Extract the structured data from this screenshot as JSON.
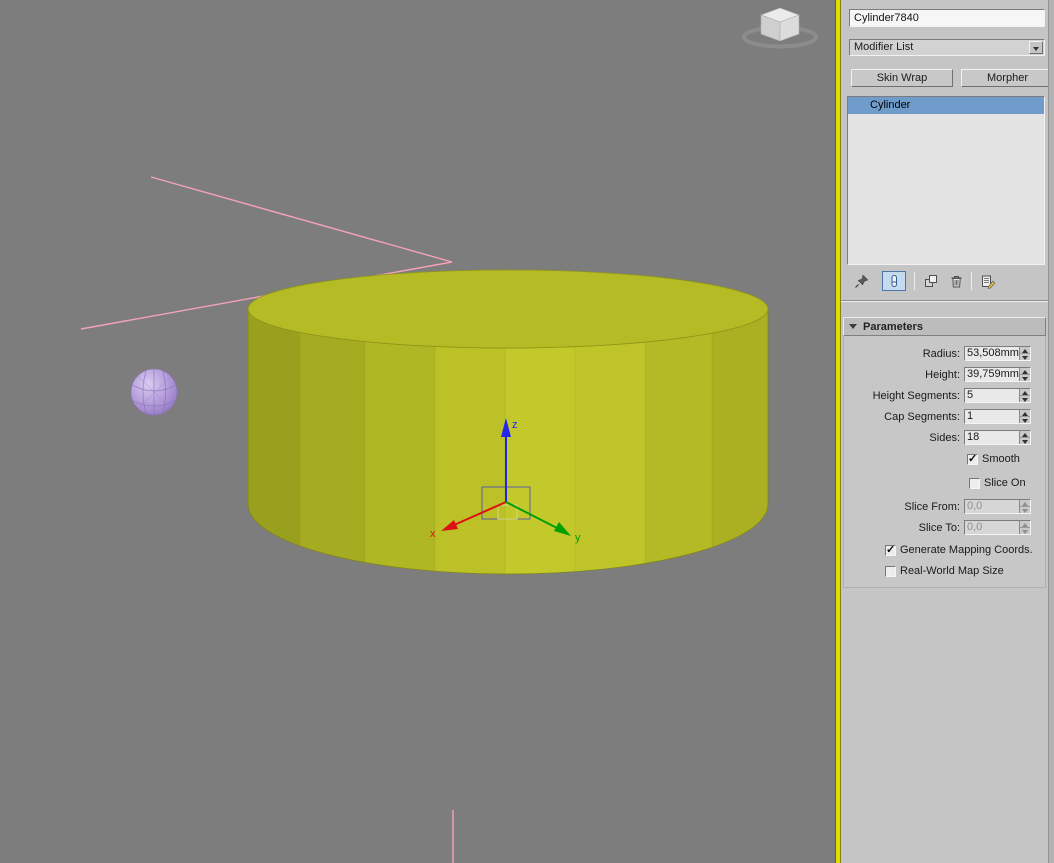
{
  "colors": {
    "viewport_bg": "#7d7d7d",
    "active_viewport_border": "#dede00",
    "panel_bg": "#c5c5c5",
    "selection_blue": "#6f9ccb",
    "cylinder_top": "#b5bb24",
    "cylinder_side": "#bcc228",
    "sphere_purple": "#b39bda",
    "spline_pink": "#f5a2b8",
    "gizmo_x_red": "#dd1111",
    "gizmo_y_green": "#00a000",
    "gizmo_z_blue": "#2525ee"
  },
  "viewport": {
    "gizmo": {
      "x": "x",
      "y": "y",
      "z": "z"
    }
  },
  "panel": {
    "object_name": "Cylinder7840",
    "modifier_list_label": "Modifier List",
    "buttons": [
      {
        "label": "Skin Wrap"
      },
      {
        "label": "Morpher"
      }
    ],
    "stack": {
      "items": [
        {
          "label": "Cylinder",
          "selected": true
        }
      ]
    },
    "stack_tools": [
      {
        "name": "pin-stack"
      },
      {
        "name": "show-end-result",
        "active": true
      },
      {
        "name": "make-unique"
      },
      {
        "name": "remove-modifier"
      },
      {
        "name": "configure-modifier-sets"
      }
    ],
    "rollout": {
      "title": "Parameters",
      "params": [
        {
          "label": "Radius:",
          "value": "53,508mm"
        },
        {
          "label": "Height:",
          "value": "39,759mm"
        },
        {
          "label": "Height Segments:",
          "value": "5"
        },
        {
          "label": "Cap Segments:",
          "value": "1"
        },
        {
          "label": "Sides:",
          "value": "18"
        }
      ],
      "smooth": {
        "label": "Smooth",
        "checked": true
      },
      "slice_on": {
        "label": "Slice On",
        "checked": false
      },
      "slice_params": [
        {
          "label": "Slice From:",
          "value": "0,0",
          "disabled": true
        },
        {
          "label": "Slice To:",
          "value": "0,0",
          "disabled": true
        }
      ],
      "gen_mapping": {
        "label": "Generate Mapping Coords.",
        "checked": true
      },
      "real_world": {
        "label": "Real-World Map Size",
        "checked": false
      }
    }
  }
}
